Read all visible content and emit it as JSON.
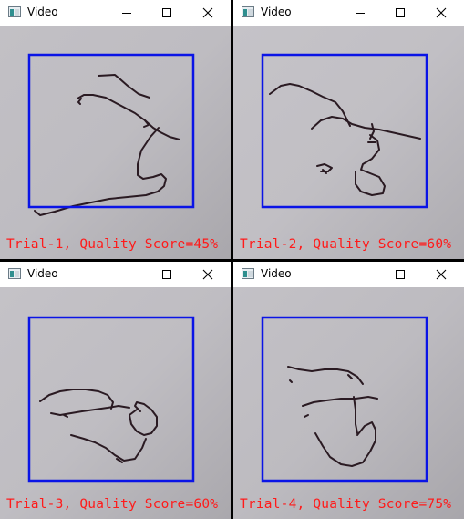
{
  "colors": {
    "roi_box": "#0a14e6",
    "score_text": "#ff1a1a",
    "ink": "#2a1a22"
  },
  "windows": [
    {
      "title": "Video",
      "label": "Trial-1, Quality Score=45%",
      "quality_score_pct": 45
    },
    {
      "title": "Video",
      "label": "Trial-2, Quality Score=60%",
      "quality_score_pct": 60
    },
    {
      "title": "Video",
      "label": "Trial-3, Quality Score=60%",
      "quality_score_pct": 60
    },
    {
      "title": "Video",
      "label": "Trial-4, Quality Score=75%",
      "quality_score_pct": 75
    }
  ],
  "icons": {
    "app": "video-window-icon",
    "minimize": "minimize-icon",
    "maximize": "maximize-icon",
    "close": "close-icon"
  }
}
